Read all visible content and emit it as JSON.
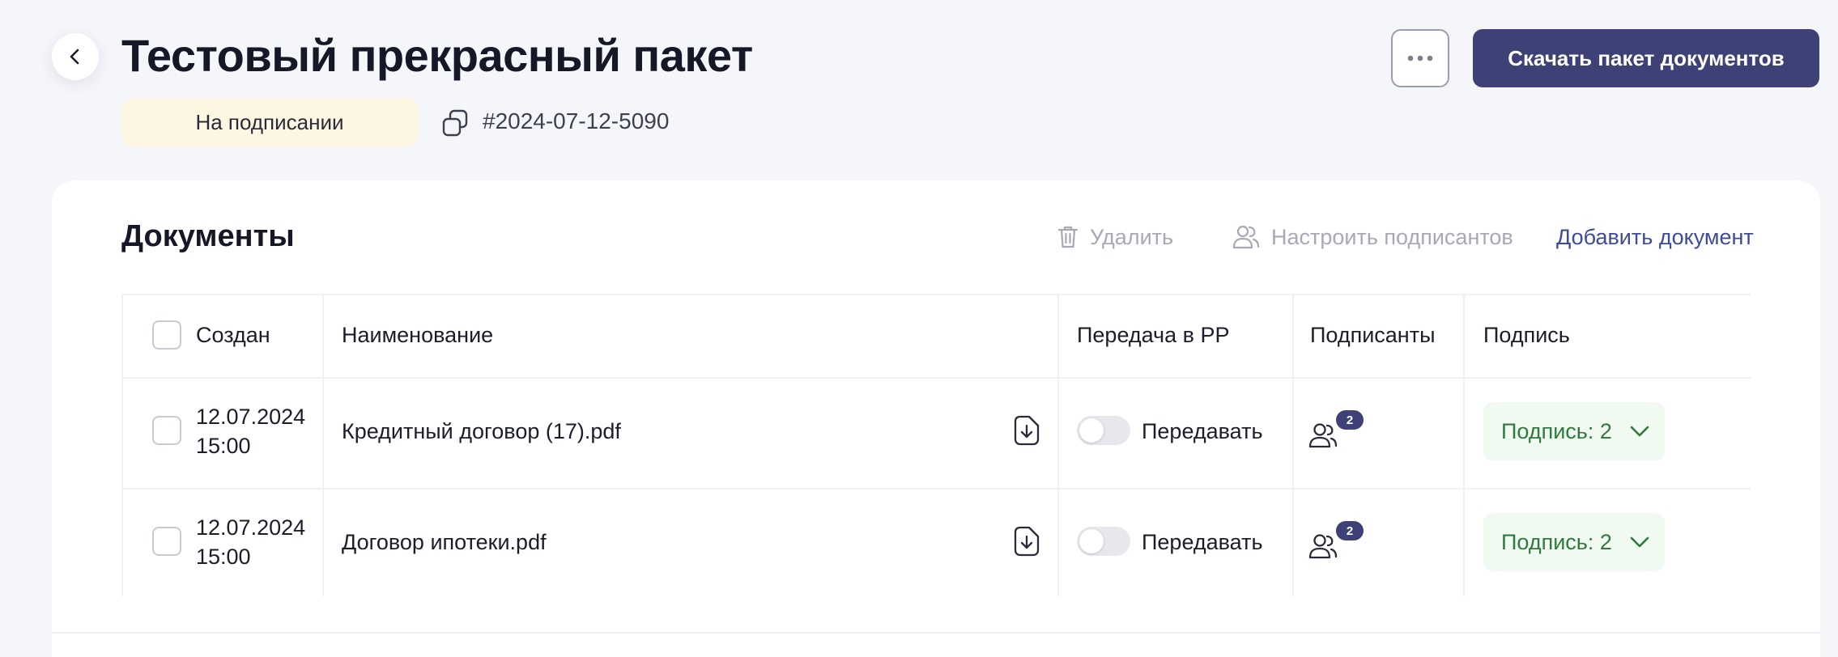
{
  "header": {
    "title": "Тестовый прекрасный пакет",
    "status": "На подписании",
    "doc_number": "#2024-07-12-5090",
    "download_button": "Скачать пакет документов"
  },
  "documents": {
    "title": "Документы",
    "actions": {
      "delete": "Удалить",
      "configure_signers": "Настроить подписантов",
      "add_document": "Добавить документ"
    },
    "columns": {
      "created": "Создан",
      "name": "Наименование",
      "transfer": "Передача в РР",
      "signers": "Подписанты",
      "signature": "Подпись"
    },
    "rows": [
      {
        "date": "12.07.2024",
        "time": "15:00",
        "name": "Кредитный договор (17).pdf",
        "transfer_label": "Передавать",
        "transfer_on": false,
        "signers_count": "2",
        "signature": "Подпись: 2"
      },
      {
        "date": "12.07.2024",
        "time": "15:00",
        "name": "Договор ипотеки.pdf",
        "transfer_label": "Передавать",
        "transfer_on": false,
        "signers_count": "2",
        "signature": "Подпись: 2"
      }
    ]
  },
  "colors": {
    "primary": "#3d4175",
    "status_bg": "#fdf6e3",
    "signature_bg": "#f0faf1",
    "signature_text": "#2f7a3d",
    "link": "#3d4b9a",
    "disabled": "#a7a9b5"
  },
  "icons": {
    "back": "chevron-left-icon",
    "copy": "copy-icon",
    "more": "more-horizontal-icon",
    "delete": "trash-icon",
    "signers": "users-icon",
    "file_download": "file-download-icon",
    "expand": "chevron-down-icon"
  }
}
